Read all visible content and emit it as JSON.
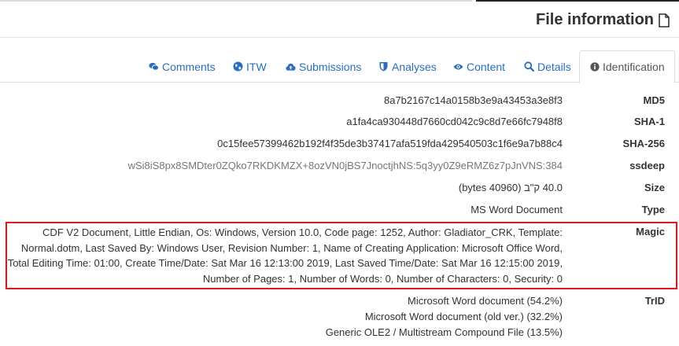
{
  "header": {
    "title": "File information"
  },
  "tabs": [
    {
      "label": "Comments",
      "icon": "comments-icon"
    },
    {
      "label": "ITW",
      "icon": "globe-icon"
    },
    {
      "label": "Submissions",
      "icon": "cloud-upload-icon"
    },
    {
      "label": "Analyses",
      "icon": "shield-icon"
    },
    {
      "label": "Content",
      "icon": "eye-icon"
    },
    {
      "label": "Details",
      "icon": "search-icon"
    },
    {
      "label": "Identification",
      "icon": "info-circle-icon",
      "active": true
    }
  ],
  "fields": {
    "md5": {
      "label": "MD5",
      "value": "8a7b2167c14a0158b3e9a43453a3e8f3"
    },
    "sha1": {
      "label": "SHA-1",
      "value": "a1fa4ca930448d7660cd042c9c8d7e66fc7948f8"
    },
    "sha256": {
      "label": "SHA-256",
      "value": "0c15fee57399462b192f4f35de3b37417afa519fda429540503c1f6e9a7b88c4"
    },
    "ssdeep": {
      "label": "ssdeep",
      "value": "wSi8iS8px8SMDter0ZQko7RKDKMZX+8ozVN0jBS7JnoctjhNS:5q3yy0Z9eRMZ6z7pJnVNS:384"
    },
    "size": {
      "label": "Size",
      "value": "40.0 ק\"ב (40960 bytes)"
    },
    "type": {
      "label": "Type",
      "value": "MS Word Document"
    },
    "magic": {
      "label": "Magic",
      "lines": [
        "CDF V2 Document, Little Endian, Os: Windows, Version 10.0, Code page: 1252, Author: Gladiator_CRK, Template:",
        "Normal.dotm, Last Saved By: Windows User, Revision Number: 1, Name of Creating Application: Microsoft Office Word,",
        "Total Editing Time: 01:00, Create Time/Date: Sat Mar 16 12:13:00 2019, Last Saved Time/Date: Sat Mar 16 12:15:00 2019,",
        "Number of Pages: 1, Number of Words: 0, Number of Characters: 0, Security: 0"
      ]
    },
    "trid": {
      "label": "TrID",
      "lines": [
        "Microsoft Word document (54.2%)",
        "Microsoft Word document (old ver.) (32.2%)",
        "Generic OLE2 / Multistream Compound File (13.5%)"
      ]
    }
  },
  "colors": {
    "link": "#2a6ebb",
    "highlight_border": "#e0161e"
  }
}
